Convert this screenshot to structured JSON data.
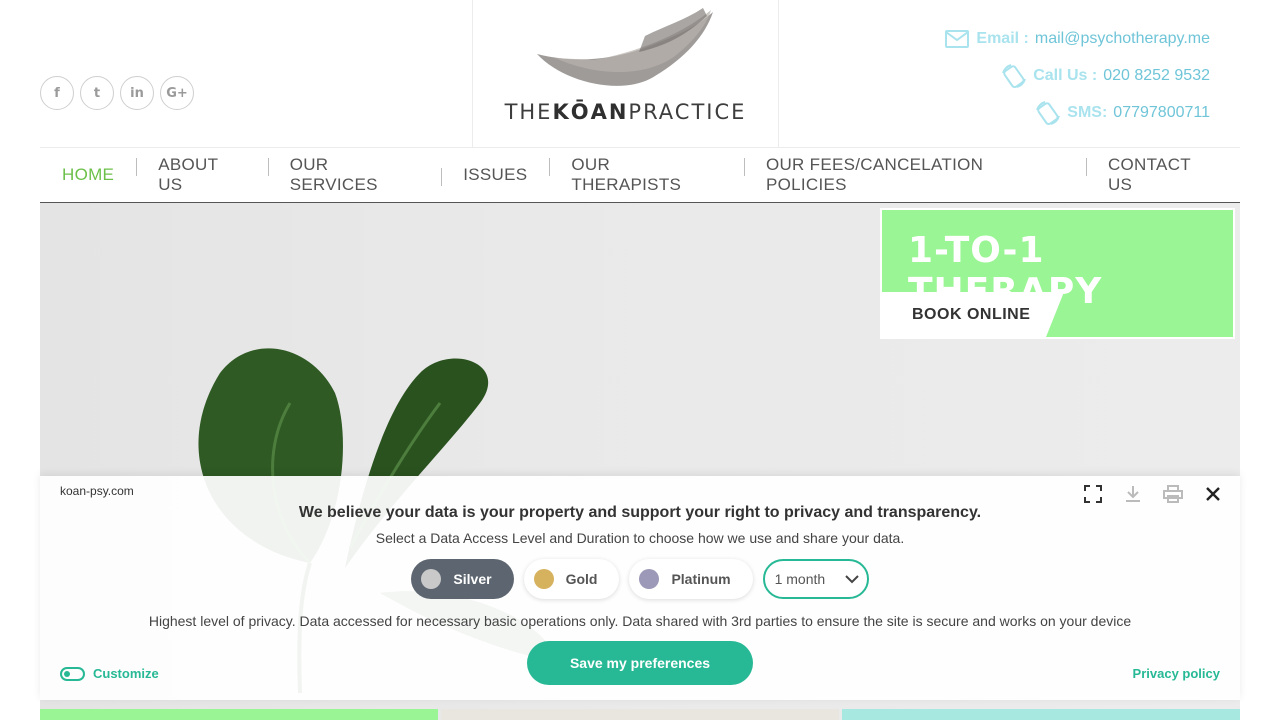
{
  "header": {
    "logo": {
      "prefix": "THE",
      "brand": "KŌAN",
      "suffix": "PRACTICE"
    },
    "social": [
      {
        "name": "facebook",
        "glyph": "f"
      },
      {
        "name": "twitter",
        "glyph": "t"
      },
      {
        "name": "linkedin",
        "glyph": "in"
      },
      {
        "name": "google-plus",
        "glyph": "G+"
      }
    ],
    "contacts": {
      "email_label": "Email :",
      "email_value": "mail@psychotherapy.me",
      "call_label": "Call Us :",
      "call_value": "020 8252 9532",
      "sms_label": "SMS:",
      "sms_value": "07797800711"
    }
  },
  "nav": {
    "items": [
      "HOME",
      "ABOUT US",
      "OUR SERVICES",
      "ISSUES",
      "OUR THERAPISTS",
      "OUR FEES/CANCELATION POLICIES",
      "CONTACT US"
    ],
    "active_index": 0
  },
  "promo": {
    "title": "1-TO-1 THERAPY",
    "button": "BOOK ONLINE"
  },
  "consent": {
    "domain": "koan-psy.com",
    "headline": "We believe your data is your property and support your right to privacy and transparency.",
    "subheadline": "Select a Data Access Level and Duration to choose how we use and share your data.",
    "levels": [
      {
        "label": "Silver",
        "color": "#c9c9c9",
        "selected": true
      },
      {
        "label": "Gold",
        "color": "#d6b25e",
        "selected": false
      },
      {
        "label": "Platinum",
        "color": "#9b98b8",
        "selected": false
      }
    ],
    "duration": "1 month",
    "description": "Highest level of privacy. Data accessed for necessary basic operations only. Data shared with 3rd parties to ensure the site is secure and works on your device",
    "save_button": "Save my preferences",
    "customize": "Customize",
    "privacy_policy": "Privacy policy"
  },
  "colors": {
    "accent_green": "#27b995",
    "nav_active": "#6cc04a",
    "promo_bg": "#9af594",
    "contact_blue": "#6fc5d8"
  }
}
